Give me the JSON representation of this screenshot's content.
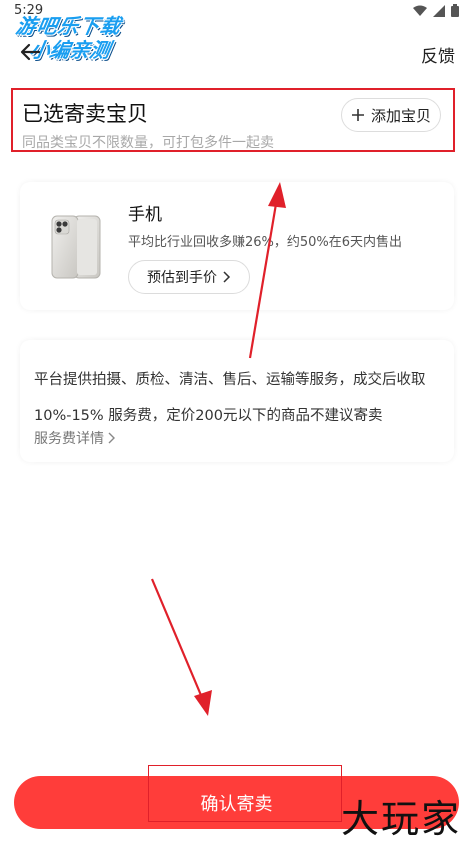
{
  "status_bar": {
    "time": "5:29"
  },
  "watermark_top": {
    "line1": "游吧乐下载",
    "line2": "小编亲测"
  },
  "header": {
    "feedback_label": "反馈"
  },
  "section": {
    "title": "已选寄卖宝贝",
    "subtitle": "同品类宝贝不限数量，可打包多件一起卖",
    "add_label": "添加宝贝"
  },
  "product": {
    "name": "手机",
    "description": "平均比行业回收多赚26%，约50%在6天内售出",
    "estimate_label": "预估到手价"
  },
  "service": {
    "text": "平台提供拍摄、质检、清洁、售后、运输等服务，成交后收取 10%-15% 服务费，定价200元以下的商品不建议寄卖",
    "link_label": "服务费详情"
  },
  "footer": {
    "confirm_label": "确认寄卖"
  },
  "watermark_bottom": {
    "text": "大玩家"
  },
  "colors": {
    "accent": "#ff3d3a",
    "annotation": "#e0202a"
  },
  "icons": {
    "back": "back-arrow-icon",
    "add": "plus-icon",
    "chevron": "chevron-right-icon"
  }
}
